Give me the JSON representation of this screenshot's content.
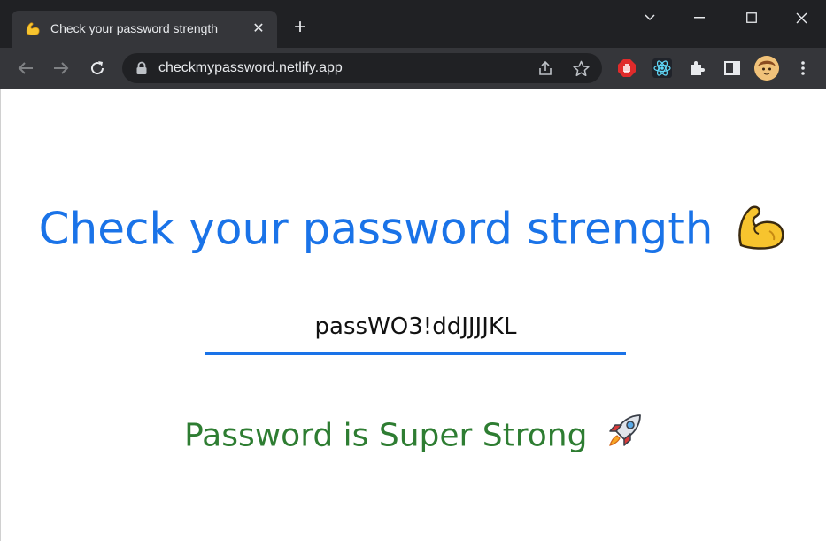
{
  "browser": {
    "tab": {
      "title": "Check your password strength",
      "favicon": "flexed-biceps-icon",
      "close_label": "✕"
    },
    "new_tab_label": "+",
    "url": "checkmypassword.netlify.app",
    "extensions": [
      "adblock-icon",
      "react-devtools-icon",
      "puzzle-extensions-icon",
      "side-panel-icon"
    ],
    "colors": {
      "titlebar": "#202124",
      "toolbar": "#35363a",
      "omnibox": "#202124"
    }
  },
  "page": {
    "heading": "Check your password strength",
    "heading_emoji": "flexed-biceps-icon",
    "password_value": "passWO3!ddJJJJKL",
    "status": "Password is Super Strong",
    "status_emoji": "rocket-icon",
    "colors": {
      "heading": "#1a73e8",
      "underline": "#1a73e8",
      "status": "#2e7d32"
    }
  }
}
